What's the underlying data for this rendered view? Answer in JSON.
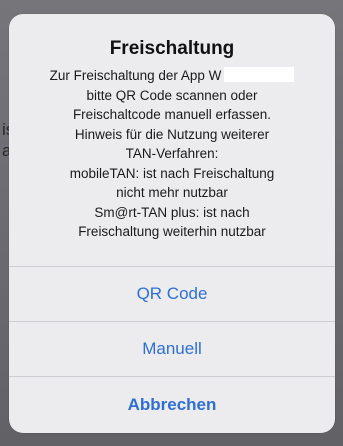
{
  "background": {
    "fragments": [
      "is",
      "a"
    ]
  },
  "alert": {
    "title": "Freischaltung",
    "message_lines": [
      "Zur Freischaltung der App W",
      "bitte QR Code scannen oder",
      "Freischaltcode manuell erfassen.",
      "Hinweis für die Nutzung weiterer",
      "TAN-Verfahren:",
      "mobileTAN: ist nach Freischaltung",
      "nicht mehr nutzbar",
      "Sm@rt-TAN plus: ist nach",
      "Freischaltung weiterhin nutzbar"
    ],
    "buttons": {
      "qr_code": "QR Code",
      "manuell": "Manuell",
      "abbrechen": "Abbrechen"
    }
  },
  "colors": {
    "accent": "#2f6fd0",
    "alert_background": "#ececee",
    "dim_background": "#6f6f72",
    "redaction": "#ffffff"
  }
}
